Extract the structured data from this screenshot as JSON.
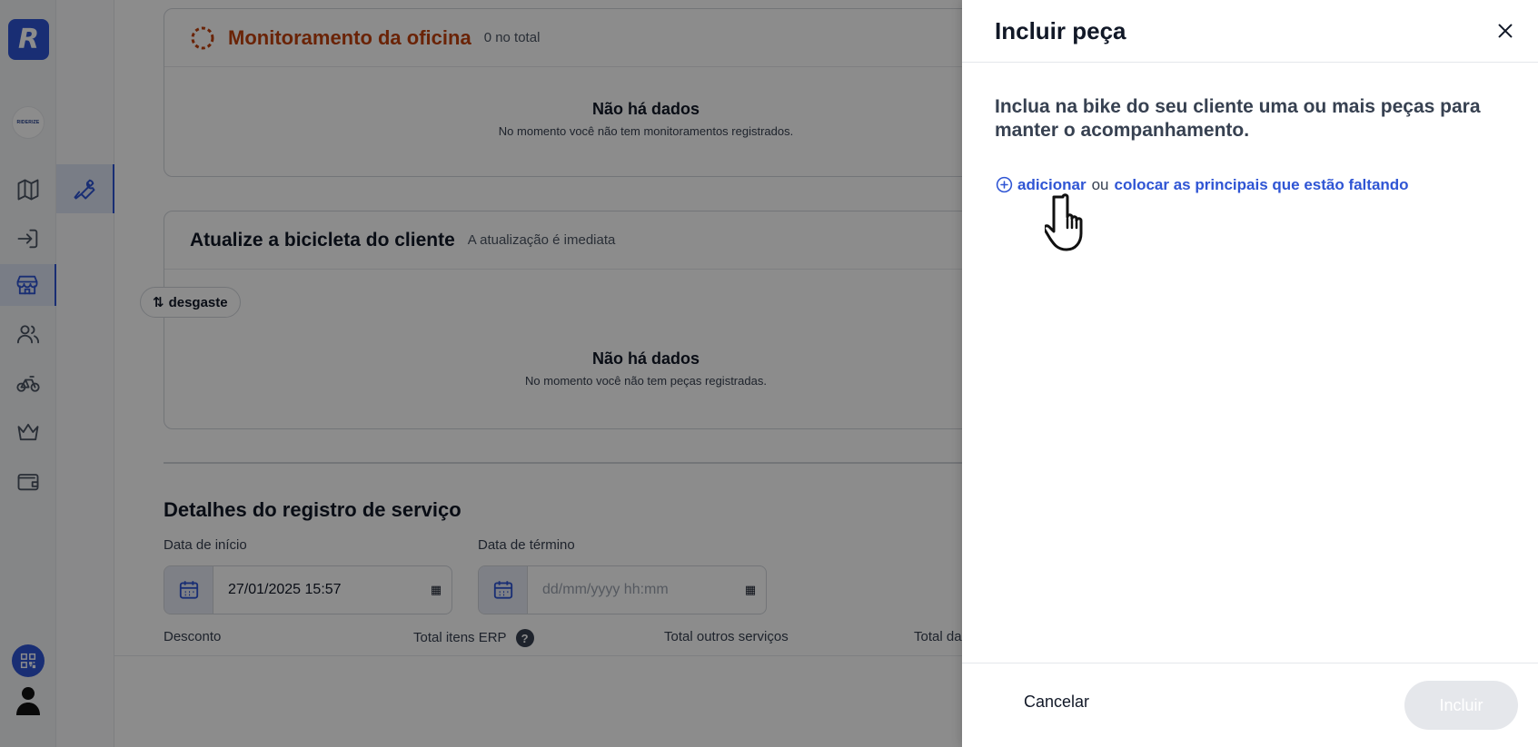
{
  "rail": {
    "logo_letter": "R",
    "brand_text": "RIDERIZE",
    "items": [
      {
        "icon": "map-icon"
      },
      {
        "icon": "sign-in-icon"
      },
      {
        "icon": "store-icon",
        "active": true
      },
      {
        "icon": "users-icon"
      },
      {
        "icon": "bike-icon"
      },
      {
        "icon": "crown-icon"
      },
      {
        "icon": "wallet-icon"
      }
    ],
    "bottom": [
      "qr-code-icon",
      "user-avatar-icon"
    ]
  },
  "subnav": {
    "items": [
      {
        "icon": "wrench-icon",
        "active": true
      }
    ]
  },
  "monitoring": {
    "title": "Monitoramento da oficina",
    "count": "0 no total",
    "empty_title": "Não há dados",
    "empty_subtitle": "No momento você não tem monitoramentos registrados."
  },
  "bike_update": {
    "title": "Atualize a bicicleta do cliente",
    "subtitle": "A atualização é imediata",
    "sort_chip": "desgaste",
    "empty_title": "Não há dados",
    "empty_subtitle": "No momento você não tem peças registradas."
  },
  "service": {
    "title": "Detalhes do registro de serviço",
    "start_label": "Data de início",
    "start_value": "27/01/2025 15:57",
    "end_label": "Data de término",
    "end_placeholder": "dd/mm/yyyy hh:mm",
    "discount_label": "Desconto",
    "erp_label": "Total itens ERP",
    "erp_help": "?",
    "other_label": "Total outros serviços",
    "total_label": "Total da"
  },
  "drawer": {
    "title": "Incluir peça",
    "description": "Inclua na bike do seu cliente uma ou mais peças para manter o acompanhamento.",
    "add_link": "adicionar",
    "or_text": "ou",
    "missing_link": "colocar as principais que estão faltando",
    "cancel": "Cancelar",
    "submit": "Incluir"
  }
}
